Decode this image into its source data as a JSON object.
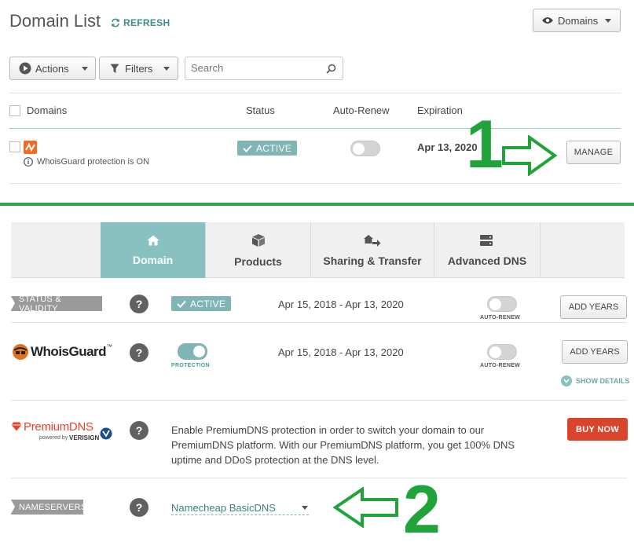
{
  "header": {
    "title": "Domain List",
    "refresh_label": "REFRESH",
    "domains_dropdown": "Domains"
  },
  "toolbar": {
    "actions_label": "Actions",
    "filters_label": "Filters",
    "search_placeholder": "Search"
  },
  "table": {
    "columns": [
      "Domains",
      "Status",
      "Auto-Renew",
      "Expiration"
    ],
    "row": {
      "status": "ACTIVE",
      "expiration": "Apr 13, 2020",
      "whoisguard_note": "WhoisGuard protection is ON",
      "manage_label": "MANAGE"
    }
  },
  "annotations": {
    "step1": "1",
    "step2": "2",
    "green": "#1fa33a"
  },
  "tabs": [
    {
      "label": "Domain",
      "icon": "home-icon",
      "active": true
    },
    {
      "label": "Products",
      "icon": "box-icon",
      "active": false
    },
    {
      "label": "Sharing & Transfer",
      "icon": "transfer-icon",
      "active": false
    },
    {
      "label": "Advanced DNS",
      "icon": "dns-icon",
      "active": false
    }
  ],
  "status_validity": {
    "tag": "STATUS & VALIDITY",
    "status": "ACTIVE",
    "dates": "Apr 15, 2018 - Apr 13, 2020",
    "autorenew_label": "AUTO-RENEW",
    "add_years_label": "ADD YEARS"
  },
  "whoisguard": {
    "logo_text": "WhoisGuard",
    "tm": "™",
    "protection_label": "PROTECTION",
    "dates": "Apr 15, 2018 - Apr 13, 2020",
    "autorenew_label": "AUTO-RENEW",
    "add_years_label": "ADD YEARS",
    "show_details_label": "SHOW DETAILS"
  },
  "premiumdns": {
    "logo_text": "PremiumDNS",
    "powered_by": "powered by",
    "verisign": "VERISIGN",
    "description": "Enable PremiumDNS protection in order to switch your domain to our PremiumDNS platform. With our PremiumDNS platform, you get 100% DNS uptime and DDoS protection at the DNS level.",
    "buy_now_label": "BUY NOW"
  },
  "nameservers": {
    "tag": "NAMESERVERS",
    "selected": "Namecheap BasicDNS"
  },
  "colors": {
    "teal": "#7fb5b5",
    "buy_red": "#d9452b"
  }
}
